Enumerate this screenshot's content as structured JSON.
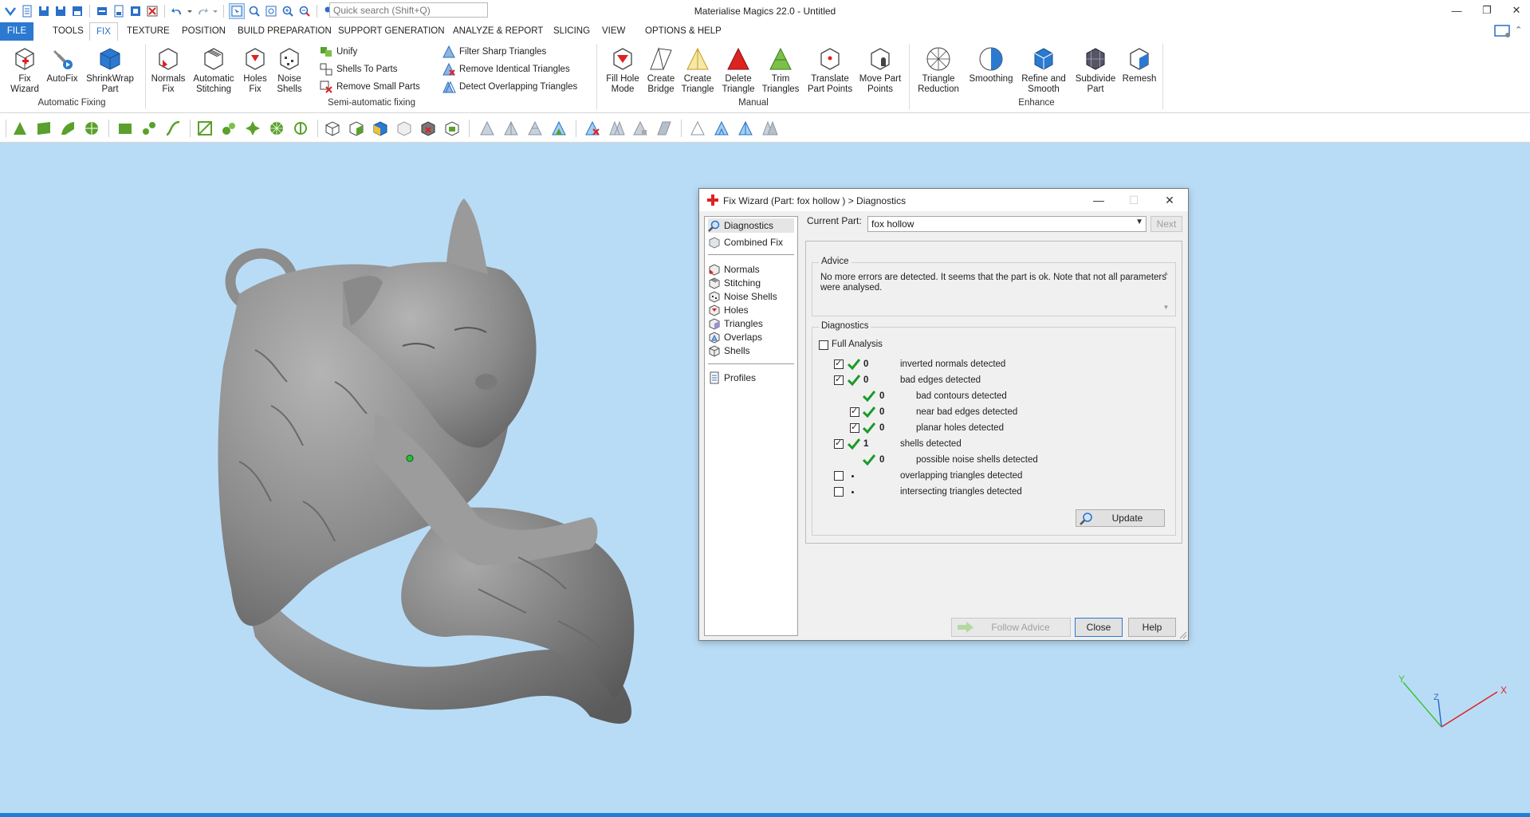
{
  "app": {
    "title": "Materialise Magics 22.0 - Untitled",
    "search_placeholder": "Quick search (Shift+Q)"
  },
  "menu": {
    "tabs": [
      "FILE",
      "TOOLS",
      "FIX",
      "TEXTURE",
      "POSITION",
      "BUILD PREPARATION",
      "SUPPORT GENERATION",
      "ANALYZE & REPORT",
      "SLICING",
      "VIEW",
      "OPTIONS & HELP"
    ],
    "active": "FIX"
  },
  "ribbon": {
    "automatic_fixing": {
      "label": "Automatic Fixing",
      "fix_wizard": [
        "Fix",
        "Wizard"
      ],
      "autofix": "AutoFix",
      "shrinkwrap": [
        "ShrinkWrap",
        "Part"
      ]
    },
    "semi_automatic": {
      "label": "Semi-automatic fixing",
      "normals_fix": [
        "Normals",
        "Fix"
      ],
      "auto_stitching": [
        "Automatic",
        "Stitching"
      ],
      "holes_fix": [
        "Holes",
        "Fix"
      ],
      "noise_shells": [
        "Noise",
        "Shells"
      ],
      "unify": "Unify",
      "shells_to_parts": "Shells To Parts",
      "remove_small_parts": "Remove Small Parts",
      "filter_sharp": "Filter Sharp Triangles",
      "remove_identical": "Remove Identical Triangles",
      "detect_overlapping": "Detect Overlapping Triangles"
    },
    "manual": {
      "label": "Manual",
      "fill_hole_mode": [
        "Fill Hole",
        "Mode"
      ],
      "create_bridge": [
        "Create",
        "Bridge"
      ],
      "create_triangle": [
        "Create",
        "Triangle"
      ],
      "delete_triangle": [
        "Delete",
        "Triangle"
      ],
      "trim_triangles": [
        "Trim",
        "Triangles"
      ],
      "translate_part_points": [
        "Translate",
        "Part Points"
      ],
      "move_part_points": [
        "Move Part",
        "Points"
      ]
    },
    "enhance": {
      "label": "Enhance",
      "triangle_reduction": [
        "Triangle",
        "Reduction"
      ],
      "smoothing": "Smoothing",
      "refine_and_smooth": [
        "Refine and",
        "Smooth"
      ],
      "subdivide_part": [
        "Subdivide",
        "Part"
      ],
      "remesh": "Remesh"
    }
  },
  "dialog": {
    "title": "Fix Wizard (Part: fox hollow ) > Diagnostics",
    "nav": {
      "diagnostics": "Diagnostics",
      "combined_fix": "Combined Fix",
      "normals": "Normals",
      "stitching": "Stitching",
      "noise_shells": "Noise Shells",
      "holes": "Holes",
      "triangles": "Triangles",
      "overlaps": "Overlaps",
      "shells": "Shells",
      "profiles": "Profiles"
    },
    "current_part_label": "Current Part:",
    "current_part_value": "fox hollow",
    "next_label": "Next",
    "advice_title": "Advice",
    "advice_text": "No more errors are detected. It seems that the part is ok. Note that not all parameters were analysed.",
    "diagnostics_title": "Diagnostics",
    "full_analysis_label": "Full Analysis",
    "rows": [
      {
        "value": "0",
        "text": "inverted normals detected"
      },
      {
        "value": "0",
        "text": "bad edges detected"
      },
      {
        "value": "0",
        "text": "bad contours detected"
      },
      {
        "value": "0",
        "text": "near bad edges detected"
      },
      {
        "value": "0",
        "text": "planar holes detected"
      },
      {
        "value": "1",
        "text": "shells detected"
      },
      {
        "value": "0",
        "text": "possible noise shells detected"
      },
      {
        "value": "",
        "text": "overlapping triangles detected"
      },
      {
        "value": "",
        "text": "intersecting triangles detected"
      }
    ],
    "update_label": "Update",
    "follow_advice_label": "Follow Advice",
    "close_label": "Close",
    "help_label": "Help"
  },
  "axes": {
    "x": "X",
    "y": "Y",
    "z": "Z"
  }
}
